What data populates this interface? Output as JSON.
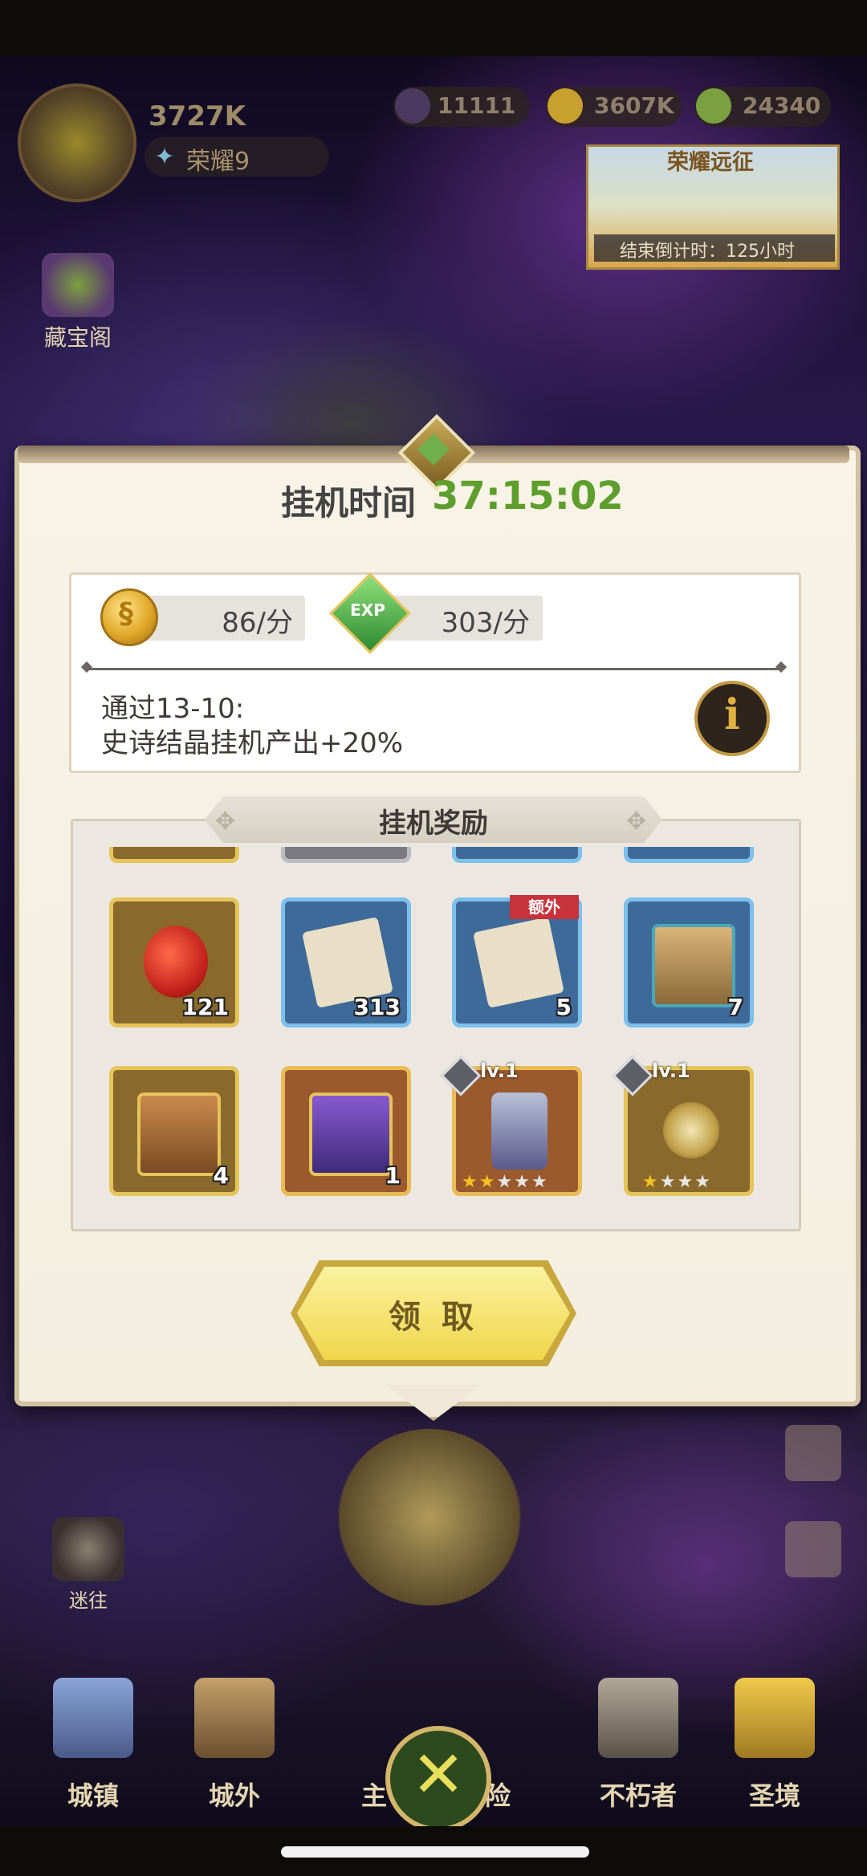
{
  "hud": {
    "power": "3727K",
    "glory_label": "荣耀9",
    "resources": [
      {
        "icon": "dark-crystal-icon",
        "value": "11111"
      },
      {
        "icon": "gold-icon",
        "value": "3607K"
      },
      {
        "icon": "dust-icon",
        "value": "24340"
      }
    ],
    "expedition": {
      "title": "荣耀远征",
      "timer": "结束倒计时：125小时"
    }
  },
  "side_buttons": [
    {
      "label": "藏宝阁"
    },
    {
      "label": "迷往"
    }
  ],
  "modal": {
    "title": "挂机时间",
    "elapsed": "37:15:02",
    "rates": [
      {
        "icon": "gold-coin-icon",
        "value": "86/分"
      },
      {
        "icon": "exp-gem-icon",
        "value": "303/分"
      }
    ],
    "bonus_line1": "通过13-10:",
    "bonus_line2": "史诗结晶挂机产出+20%",
    "info_glyph": "i",
    "rewards_title": "挂机奖励",
    "rewards_row1": [
      {
        "name": "red-fruit",
        "count": "121",
        "frame": "gold"
      },
      {
        "name": "scroll",
        "count": "313",
        "frame": "blue"
      },
      {
        "name": "scroll-extra",
        "count": "5",
        "frame": "blue",
        "tag": "额外"
      },
      {
        "name": "blue-chest",
        "count": "7",
        "frame": "blue"
      }
    ],
    "rewards_row2": [
      {
        "name": "gold-chest",
        "count": "4",
        "frame": "gold"
      },
      {
        "name": "purple-chest",
        "count": "1",
        "frame": "orange"
      },
      {
        "name": "boots",
        "level": "lv.1",
        "frame": "orange",
        "stars_filled": 2,
        "stars_total": 5
      },
      {
        "name": "amulet",
        "level": "lv.1",
        "frame": "gold",
        "stars_filled": 1,
        "stars_total": 4
      }
    ],
    "claim_label": "领 取"
  },
  "nav": [
    {
      "label": "城镇"
    },
    {
      "label": "城外"
    },
    {
      "label": "主"
    },
    {
      "label": "险"
    },
    {
      "label": "不朽者"
    },
    {
      "label": "圣境"
    }
  ],
  "battle_glyph": "✕"
}
